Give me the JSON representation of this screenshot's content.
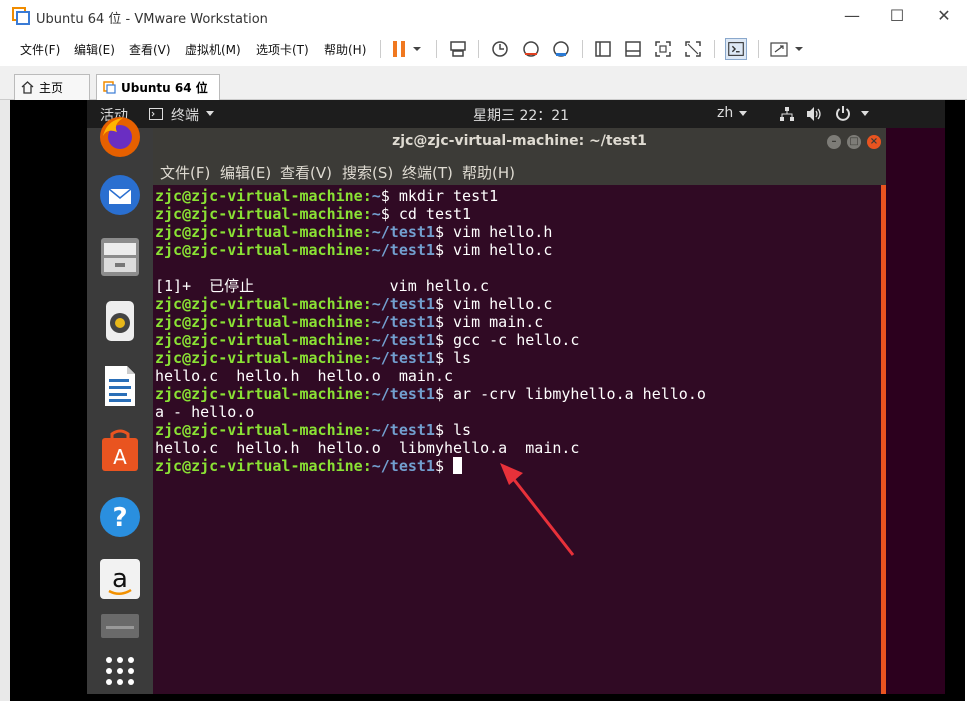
{
  "window": {
    "title": "Ubuntu 64 位 - VMware Workstation"
  },
  "menu": [
    {
      "id": "file",
      "label": "文件(F)"
    },
    {
      "id": "edit",
      "label": "编辑(E)"
    },
    {
      "id": "view",
      "label": "查看(V)"
    },
    {
      "id": "vm",
      "label": "虚拟机(M)"
    },
    {
      "id": "tabs",
      "label": "选项卡(T)"
    },
    {
      "id": "help",
      "label": "帮助(H)"
    }
  ],
  "tabs": [
    {
      "label": "主页",
      "active": false
    },
    {
      "label": "Ubuntu 64 位",
      "active": true
    }
  ],
  "ubuntu": {
    "activities": "活动",
    "app_menu": "终端",
    "clock": "星期三 22：21",
    "input_method": "zh"
  },
  "terminal": {
    "title": "zjc@zjc-virtual-machine: ~/test1",
    "menu": [
      "文件(F)",
      "编辑(E)",
      "查看(V)",
      "搜索(S)",
      "终端(T)",
      "帮助(H)"
    ],
    "lines": [
      {
        "type": "prompt",
        "user": "zjc@zjc-virtual-machine",
        "path": "~",
        "cmd": "mkdir test1"
      },
      {
        "type": "prompt",
        "user": "zjc@zjc-virtual-machine",
        "path": "~",
        "cmd": "cd test1"
      },
      {
        "type": "prompt",
        "user": "zjc@zjc-virtual-machine",
        "path": "~/test1",
        "cmd": "vim hello.h"
      },
      {
        "type": "prompt",
        "user": "zjc@zjc-virtual-machine",
        "path": "~/test1",
        "cmd": "vim hello.c"
      },
      {
        "type": "text",
        "text": ""
      },
      {
        "type": "text",
        "text": "[1]+  已停止               vim hello.c"
      },
      {
        "type": "prompt",
        "user": "zjc@zjc-virtual-machine",
        "path": "~/test1",
        "cmd": "vim hello.c"
      },
      {
        "type": "prompt",
        "user": "zjc@zjc-virtual-machine",
        "path": "~/test1",
        "cmd": "vim main.c"
      },
      {
        "type": "prompt",
        "user": "zjc@zjc-virtual-machine",
        "path": "~/test1",
        "cmd": "gcc -c hello.c"
      },
      {
        "type": "prompt",
        "user": "zjc@zjc-virtual-machine",
        "path": "~/test1",
        "cmd": "ls"
      },
      {
        "type": "text",
        "text": "hello.c  hello.h  hello.o  main.c"
      },
      {
        "type": "prompt",
        "user": "zjc@zjc-virtual-machine",
        "path": "~/test1",
        "cmd": "ar -crv libmyhello.a hello.o"
      },
      {
        "type": "text",
        "text": "a - hello.o"
      },
      {
        "type": "prompt",
        "user": "zjc@zjc-virtual-machine",
        "path": "~/test1",
        "cmd": "ls"
      },
      {
        "type": "text",
        "text": "hello.c  hello.h  hello.o  libmyhello.a  main.c"
      },
      {
        "type": "prompt",
        "user": "zjc@zjc-virtual-machine",
        "path": "~/test1",
        "cmd": "",
        "cursor": true
      }
    ]
  },
  "colors": {
    "prompt_user": "#8ae234",
    "prompt_path": "#729fcf",
    "terminal_bg": "#300a24",
    "accent": "#e95420",
    "annotation": "#e8313a"
  }
}
